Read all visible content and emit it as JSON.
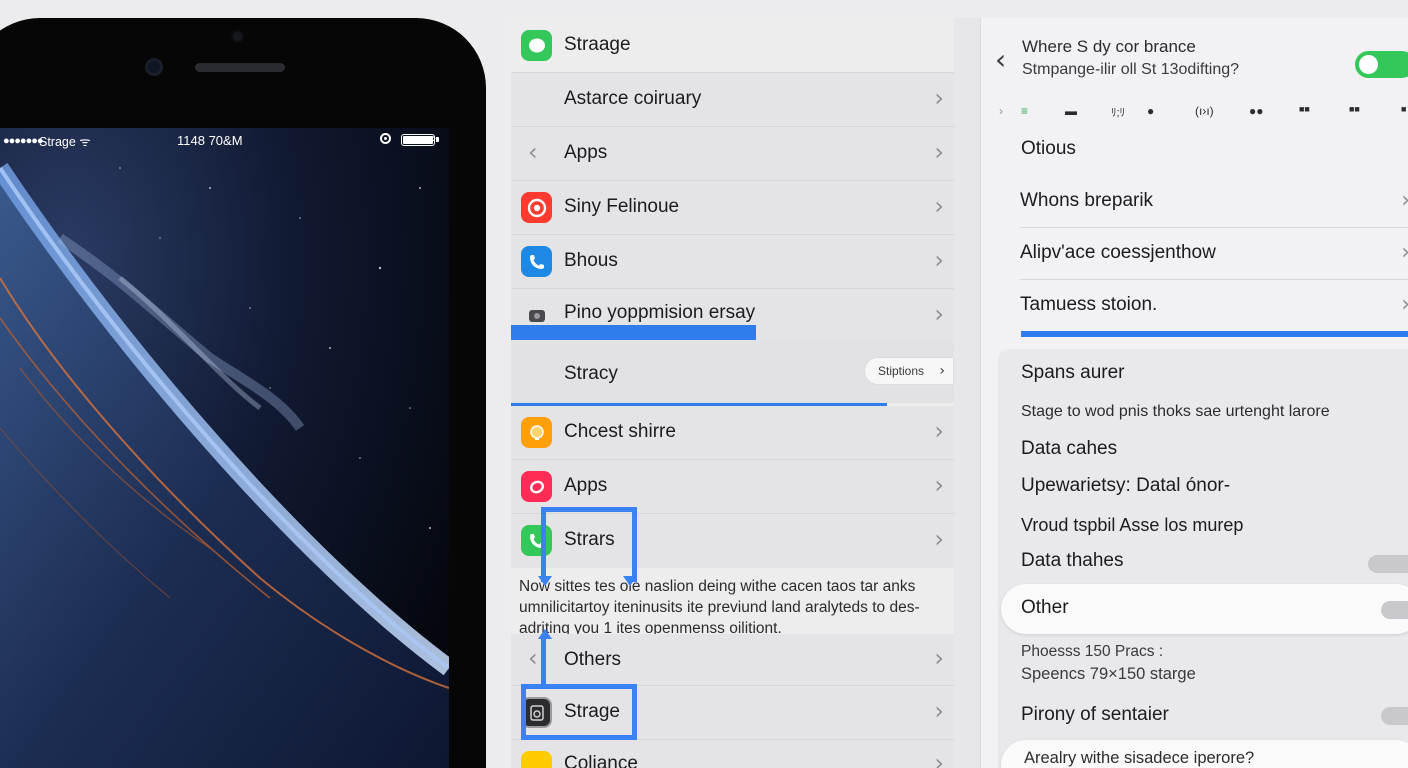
{
  "phone": {
    "status_dots": "●●●●●●●",
    "carrier": "Strage ᯤ",
    "time": "1148 70&M",
    "wallpaper": "earth-from-space",
    "page_dots": 3
  },
  "settings": {
    "rows": [
      {
        "label": "Straage",
        "icon": "messages-icon",
        "icon_color": "#34c759"
      },
      {
        "label": "Astarce coiruary"
      },
      {
        "label": "Apps"
      },
      {
        "label": "Siny Felinoue",
        "icon": "target-icon",
        "icon_color": "#ff3b30"
      },
      {
        "label": "Bhous",
        "icon": "phone-icon",
        "icon_color": "#1e88e5"
      },
      {
        "label": "Pino yoppmision ersay",
        "icon": "photo-icon",
        "icon_color": "#8e8e93"
      },
      {
        "label": "Stracy"
      },
      {
        "label": "Chcest shirre",
        "icon": "bulb-icon",
        "icon_color": "#ff9500"
      },
      {
        "label": "Apps",
        "icon": "heart-icon",
        "icon_color": "#ff2d55"
      },
      {
        "label": "Strars",
        "icon": "phone-icon",
        "icon_color": "#34c759"
      },
      {
        "label": "Others"
      },
      {
        "label": "Strage",
        "icon": "storage-icon",
        "icon_color": "#3a3a3c"
      },
      {
        "label": "Coliance",
        "icon": "settings-icon",
        "icon_color": "#ffcc00"
      }
    ],
    "pill_label": "Stiptions",
    "note": "Now sittes tes ole naslion deing withe cacen taos tar anks umnilicitartoy iteninusits ite previund land aralyteds to des-adriting you 1 ites openmenss oilitiont."
  },
  "right": {
    "header_line1": "Where S dy cor brance",
    "header_line2": "Stmpange-ilir oll St 13odifting?",
    "toggle_on": true,
    "icon_strip": [
      "›",
      "≡",
      "▬",
      "ﾘ;ﾘ",
      "●",
      "(ı›ı)",
      "●●",
      "■■",
      "■■",
      "■"
    ],
    "list_title": "Otious",
    "rows": [
      "Whons breparik",
      "Alipv'ace coessjenthow",
      "Tamuess stoion."
    ],
    "section_title": "Spans aurer",
    "subtitle": "Stage to wod pnis thoks sae urtenght larore",
    "data_caches": "Data cahes",
    "upewarietsy": "Upewarietsy: Datal ónor-",
    "vroud": "Vroud tspbil Asse los murep",
    "data_thahes": "Data thahes",
    "other": "Other",
    "phoesses": "Phoesss 150 Pracs :",
    "speencs": "Speencs 79×150 starge",
    "pirony": "Pirony of sentaier",
    "bottom_question": "Arealry withe sisadece iperore?"
  },
  "colors": {
    "accent_blue": "#2f7ded",
    "toggle_green": "#34c759"
  }
}
